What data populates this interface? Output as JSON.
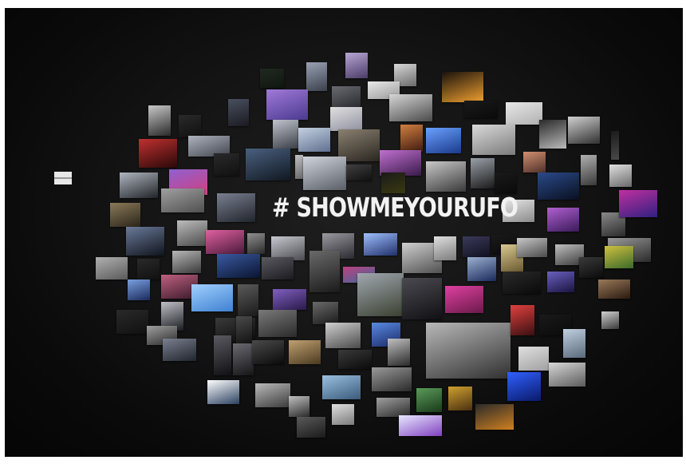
{
  "scene": {
    "wall_text": "# SHOWMEYOURUFO",
    "wall_color": "#111111",
    "text_color": "#f2f2f2"
  }
}
